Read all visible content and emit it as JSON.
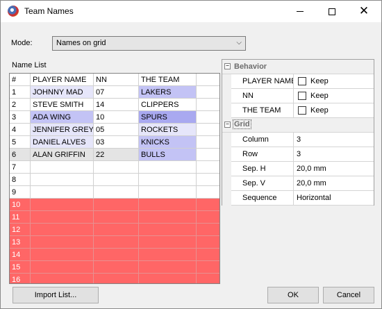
{
  "window": {
    "title": "Team Names"
  },
  "mode": {
    "label": "Mode:",
    "value": "Names on grid"
  },
  "name_list": {
    "label": "Name List",
    "columns": [
      "#",
      "PLAYER NAME",
      "NN",
      "THE TEAM",
      ""
    ],
    "rows": [
      {
        "num": "1",
        "player": "JOHNNY MAD",
        "nn": "07",
        "team": "LAKERS"
      },
      {
        "num": "2",
        "player": "STEVE SMITH",
        "nn": "14",
        "team": "CLIPPERS"
      },
      {
        "num": "3",
        "player": "ADA WING",
        "nn": "10",
        "team": "SPURS"
      },
      {
        "num": "4",
        "player": "JENNIFER GREY",
        "nn": "05",
        "team": "ROCKETS"
      },
      {
        "num": "5",
        "player": "DANIEL ALVES",
        "nn": "03",
        "team": "KNICKS"
      },
      {
        "num": "6",
        "player": "ALAN GRIFFIN",
        "nn": "22",
        "team": "BULLS"
      },
      {
        "num": "7",
        "player": "",
        "nn": "",
        "team": ""
      },
      {
        "num": "8",
        "player": "",
        "nn": "",
        "team": ""
      },
      {
        "num": "9",
        "player": "",
        "nn": "",
        "team": ""
      },
      {
        "num": "10",
        "player": "",
        "nn": "",
        "team": ""
      },
      {
        "num": "11",
        "player": "",
        "nn": "",
        "team": ""
      },
      {
        "num": "12",
        "player": "",
        "nn": "",
        "team": ""
      },
      {
        "num": "13",
        "player": "",
        "nn": "",
        "team": ""
      },
      {
        "num": "14",
        "player": "",
        "nn": "",
        "team": ""
      },
      {
        "num": "15",
        "player": "",
        "nn": "",
        "team": ""
      },
      {
        "num": "16",
        "player": "",
        "nn": "",
        "team": ""
      }
    ]
  },
  "properties": {
    "behavior": {
      "label": "Behavior",
      "items": [
        {
          "name": "PLAYER NAME",
          "value": "Keep"
        },
        {
          "name": "NN",
          "value": "Keep"
        },
        {
          "name": "THE TEAM",
          "value": "Keep"
        }
      ]
    },
    "grid": {
      "label": "Grid",
      "items": [
        {
          "name": "Column",
          "value": "3"
        },
        {
          "name": "Row",
          "value": "3"
        },
        {
          "name": "Sep. H",
          "value": "20,0 mm"
        },
        {
          "name": "Sep. V",
          "value": "20,0 mm"
        },
        {
          "name": "Sequence",
          "value": "Horizontal"
        }
      ]
    }
  },
  "buttons": {
    "import": "Import List...",
    "ok": "OK",
    "cancel": "Cancel"
  },
  "colors": {
    "over_capacity_row": "#ff6666",
    "highlight": "#c3c3f5"
  }
}
